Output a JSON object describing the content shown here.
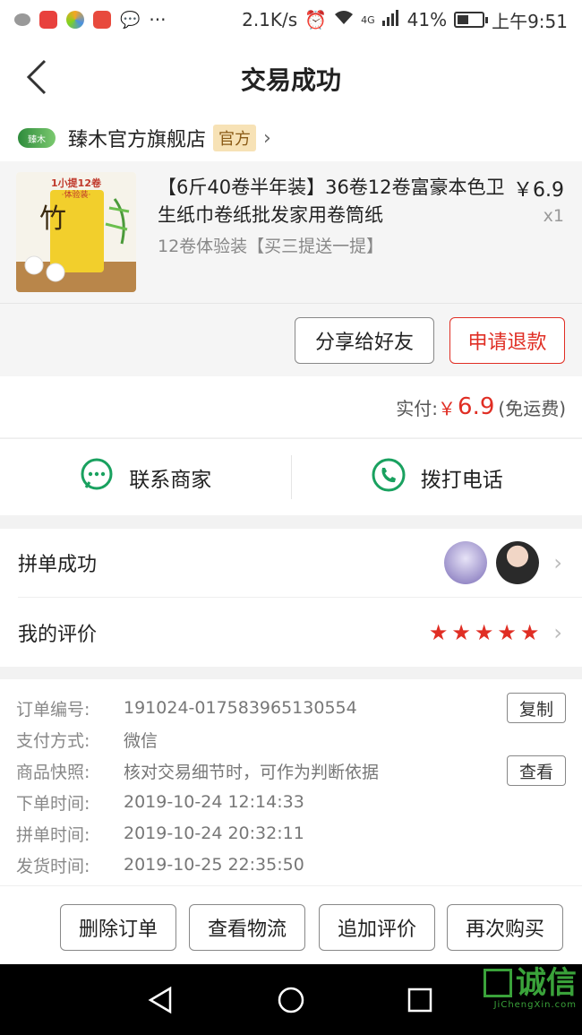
{
  "status_bar": {
    "net_speed": "2.1K/s",
    "network": "4G",
    "battery": "41%",
    "time": "上午9:51",
    "app_icons": [
      "weather-icon",
      "app-red-icon",
      "browser-icon",
      "news-icon",
      "wechat-icon",
      "more-dots-icon"
    ]
  },
  "header": {
    "title": "交易成功"
  },
  "store": {
    "name": "臻木官方旗舰店",
    "badge": "官方",
    "logo_text": "臻木"
  },
  "product": {
    "title": "【6斤40卷半年装】36卷12卷富豪本色卫生纸巾卷纸批发家用卷筒纸",
    "spec": "12卷体验装【买三提送一提】",
    "price": "￥6.9",
    "quantity": "x1",
    "thumb_label": "1小提12卷",
    "thumb_sub": "·体验装·"
  },
  "actions": {
    "share": "分享给好友",
    "refund": "申请退款"
  },
  "payment": {
    "label": "实付:",
    "currency": "￥",
    "amount": "6.9",
    "note": "(免运费)"
  },
  "contact": {
    "merchant": "联系商家",
    "phone": "拨打电话"
  },
  "group": {
    "label": "拼单成功"
  },
  "review": {
    "label": "我的评价",
    "rating": 5
  },
  "order_info": {
    "order_no_label": "订单编号:",
    "order_no": "191024-017583965130554",
    "copy": "复制",
    "pay_method_label": "支付方式:",
    "pay_method": "微信",
    "snapshot_label": "商品快照:",
    "snapshot": "核对交易细节时，可作为判断依据",
    "view": "查看",
    "order_time_label": "下单时间:",
    "order_time": "2019-10-24 12:14:33",
    "group_time_label": "拼单时间:",
    "group_time": "2019-10-24 20:32:11",
    "ship_time_label": "发货时间:",
    "ship_time": "2019-10-25 22:35:50"
  },
  "bottom": {
    "delete": "删除订单",
    "logistics": "查看物流",
    "add_review": "追加评价",
    "buy_again": "再次购买"
  },
  "watermark": {
    "text": "诚信",
    "sub": "JiChengXin.com"
  },
  "colors": {
    "accent": "#e02e24",
    "contact_green": "#19a15f",
    "badge_bg": "#f7e2b6"
  }
}
